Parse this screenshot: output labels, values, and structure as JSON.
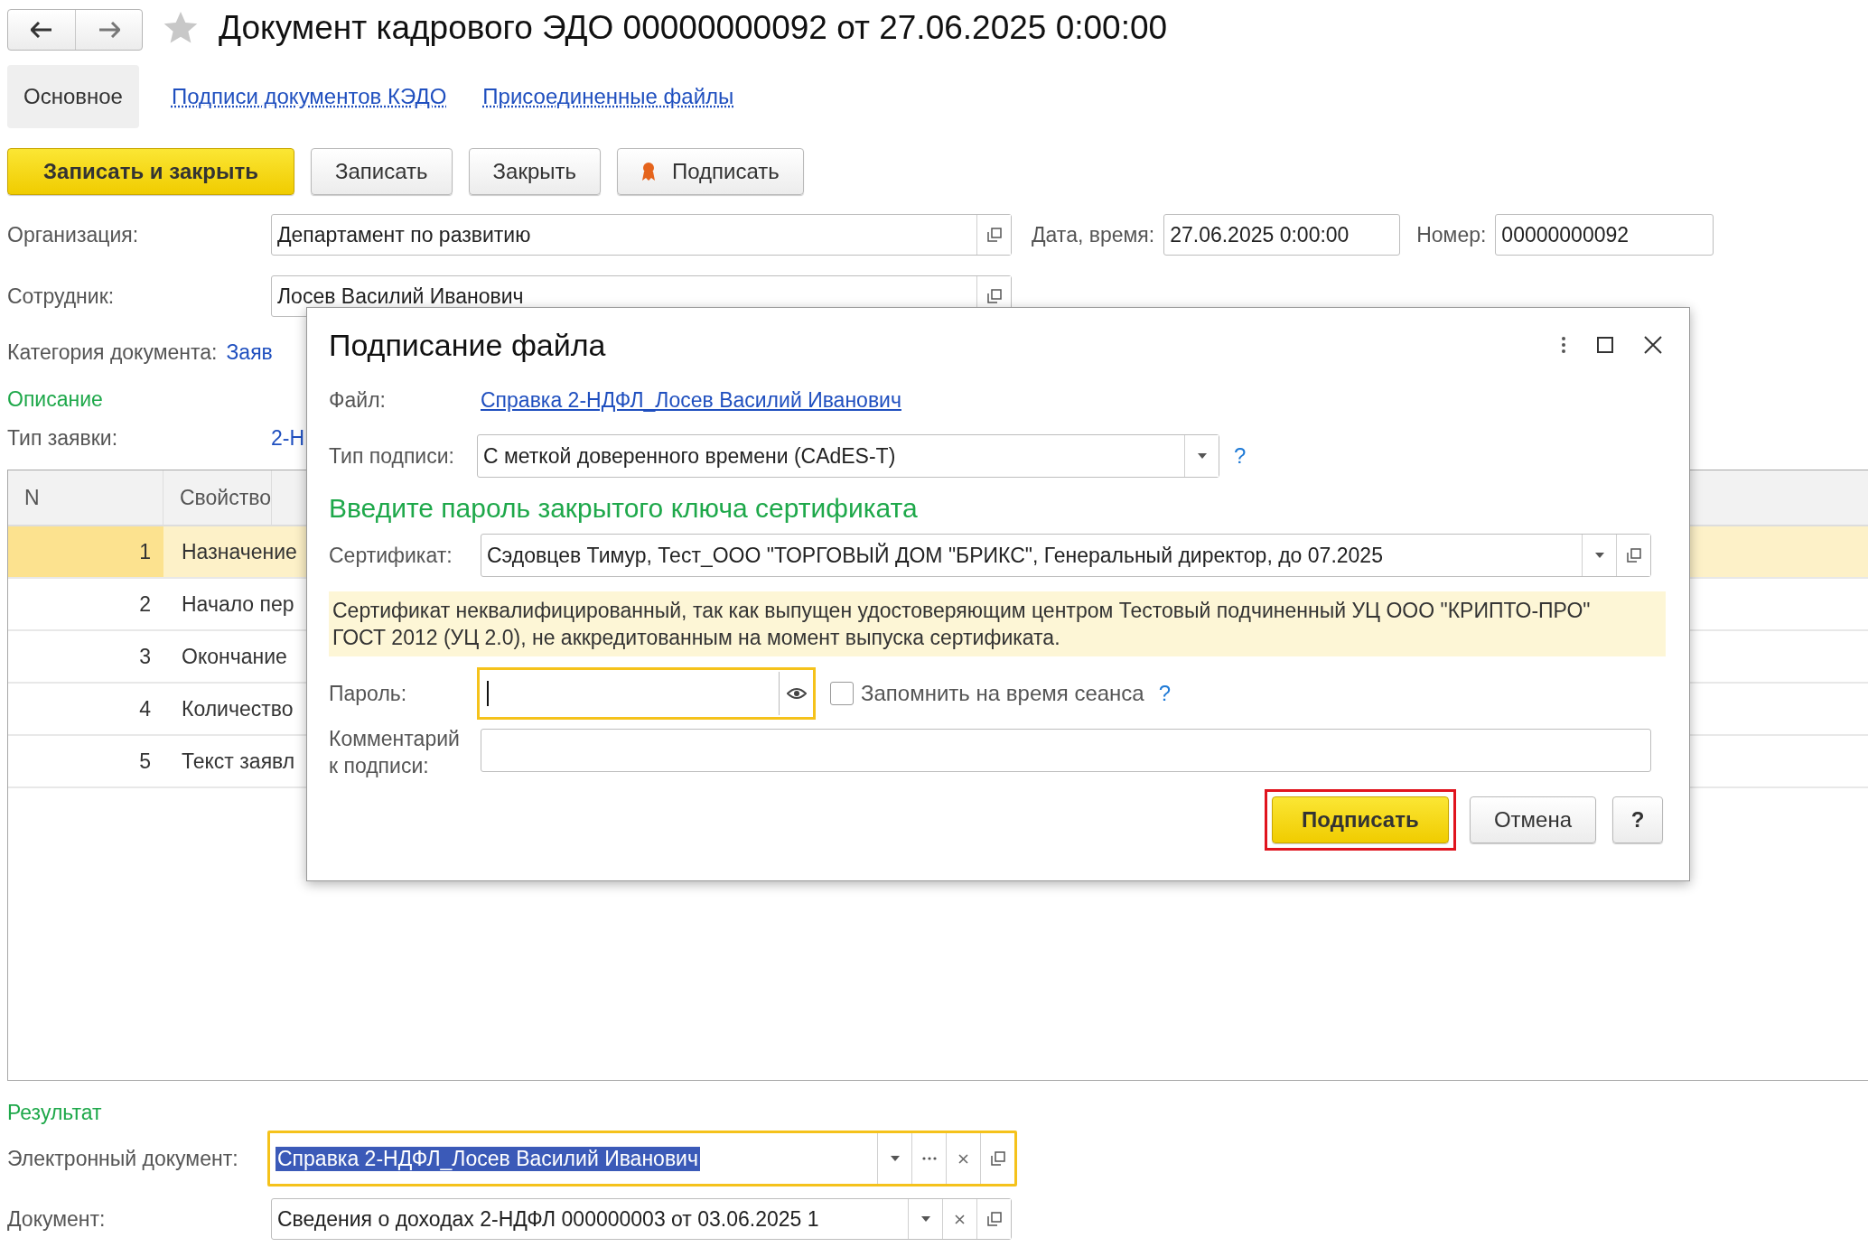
{
  "title": "Документ кадрового ЭДО 00000000092 от 27.06.2025 0:00:00",
  "favorite": false,
  "tabs": [
    {
      "label": "Основное",
      "selected": true
    },
    {
      "label": "Подписи документов КЭДО",
      "selected": false
    },
    {
      "label": "Присоединенные файлы",
      "selected": false
    }
  ],
  "toolbar": [
    {
      "label": "Записать и закрыть",
      "kind": "primary"
    },
    {
      "label": "Записать",
      "kind": "plain"
    },
    {
      "label": "Закрыть",
      "kind": "plain"
    },
    {
      "label": "Подписать",
      "kind": "sign"
    }
  ],
  "organization": {
    "label": "Организация:",
    "value": "Департамент по развитию"
  },
  "date": {
    "label": "Дата, время:",
    "value": "27.06.2025  0:00:00"
  },
  "number": {
    "label": "Номер:",
    "value": "00000000092"
  },
  "employee": {
    "label": "Сотрудник:",
    "value": "Лосев Василий Иванович"
  },
  "category": {
    "label": "Категория документа:",
    "value": "Заяв"
  },
  "description_heading": "Описание",
  "request_type": {
    "label": "Тип заявки:",
    "value": "2-Н"
  },
  "table": {
    "columns": [
      "N",
      "Свойство"
    ],
    "rows": [
      {
        "n": "1",
        "property": "Назначение",
        "selected": true
      },
      {
        "n": "2",
        "property": "Начало пер",
        "selected": false
      },
      {
        "n": "3",
        "property": "Окончание",
        "selected": false
      },
      {
        "n": "4",
        "property": "Количество",
        "selected": false
      },
      {
        "n": "5",
        "property": "Текст заявл",
        "selected": false
      }
    ]
  },
  "result_heading": "Результат",
  "e_document": {
    "label": "Электронный документ:",
    "value": "Справка 2-НДФЛ_Лосев Василий Иванович",
    "focused": true
  },
  "document": {
    "label": "Документ:",
    "value": "Сведения о доходах 2-НДФЛ 000000003 от 03.06.2025 1"
  },
  "dialog": {
    "title": "Подписание файла",
    "file": {
      "label": "Файл:",
      "link": "Справка 2-НДФЛ_Лосев Василий Иванович"
    },
    "signature_type": {
      "label": "Тип подписи:",
      "value": "С меткой доверенного времени (CAdES-T)",
      "help": "?"
    },
    "heading": "Введите пароль закрытого ключа сертификата",
    "certificate": {
      "label": "Сертификат:",
      "value": "Сэдовцев Тимур, Тест_ООО \"ТОРГОВЫЙ ДОМ \"БРИКС\", Генеральный директор, до 07.2025"
    },
    "warning": "Сертификат неквалифицированный, так как выпущен удостоверяющим центром Тестовый подчиненный УЦ ООО \"КРИПТО-ПРО\" ГОСТ 2012 (УЦ 2.0), не аккредитованным на момент выпуска сертификата.",
    "password": {
      "label": "Пароль:",
      "focused": true
    },
    "remember": {
      "label": "Запомнить на время сеанса",
      "checked": false,
      "help": "?"
    },
    "comment": {
      "label": "Комментарий к подписи:"
    },
    "buttons": [
      {
        "label": "Подписать",
        "kind": "primary",
        "highlighted": true
      },
      {
        "label": "Отмена",
        "kind": "plain",
        "highlighted": false
      },
      {
        "label": "?",
        "kind": "help",
        "highlighted": false
      }
    ]
  }
}
